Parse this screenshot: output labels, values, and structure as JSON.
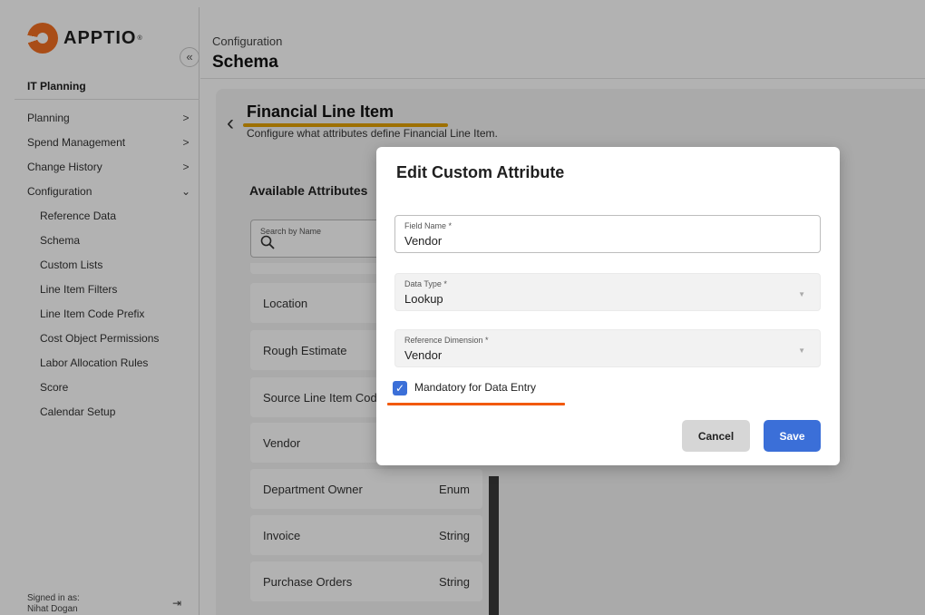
{
  "brand": {
    "name": "APPTIO",
    "tm": "®"
  },
  "sidebar": {
    "collapse_icon": "«",
    "section_title": "IT Planning",
    "items": [
      {
        "label": "Planning",
        "chevron": ">"
      },
      {
        "label": "Spend Management",
        "chevron": ">"
      },
      {
        "label": "Change History",
        "chevron": ">"
      },
      {
        "label": "Configuration",
        "chevron": "⌄"
      },
      {
        "label": "Reference Data"
      },
      {
        "label": "Schema"
      },
      {
        "label": "Custom Lists"
      },
      {
        "label": "Line Item Filters"
      },
      {
        "label": "Line Item Code Prefix"
      },
      {
        "label": "Cost Object Permissions"
      },
      {
        "label": "Labor Allocation Rules"
      },
      {
        "label": "Score"
      },
      {
        "label": "Calendar Setup"
      }
    ],
    "signed_in_label": "Signed in as:",
    "signed_in_user": "Nihat Dogan",
    "logout_icon": "⇥"
  },
  "header": {
    "breadcrumb": "Configuration",
    "title": "Schema"
  },
  "main": {
    "back_icon": "‹",
    "entity_title": "Financial Line Item",
    "entity_description": "Configure what attributes define Financial Line Item.",
    "available_title": "Available Attributes",
    "search_label": "Search by Name",
    "attributes": [
      {
        "name": "Location",
        "type": ""
      },
      {
        "name": "Rough Estimate",
        "type": ""
      },
      {
        "name": "Source Line Item Cod",
        "type": ""
      },
      {
        "name": "Vendor",
        "type": ""
      },
      {
        "name": "Department Owner",
        "type": "Enum"
      },
      {
        "name": "Invoice",
        "type": "String"
      },
      {
        "name": "Purchase Orders",
        "type": "String"
      }
    ]
  },
  "modal": {
    "title": "Edit Custom Attribute",
    "field_name": {
      "label": "Field Name *",
      "value": "Vendor"
    },
    "data_type": {
      "label": "Data Type *",
      "value": "Lookup"
    },
    "reference_dimension": {
      "label": "Reference Dimension *",
      "value": "Vendor"
    },
    "mandatory": {
      "label": "Mandatory for Data Entry",
      "checked": true
    },
    "cancel_label": "Cancel",
    "save_label": "Save"
  },
  "colors": {
    "accent": "#3b6fd8",
    "highlight_title": "#e2a100",
    "highlight_checkbox": "#f25a0c",
    "brand": "#f36f21"
  }
}
